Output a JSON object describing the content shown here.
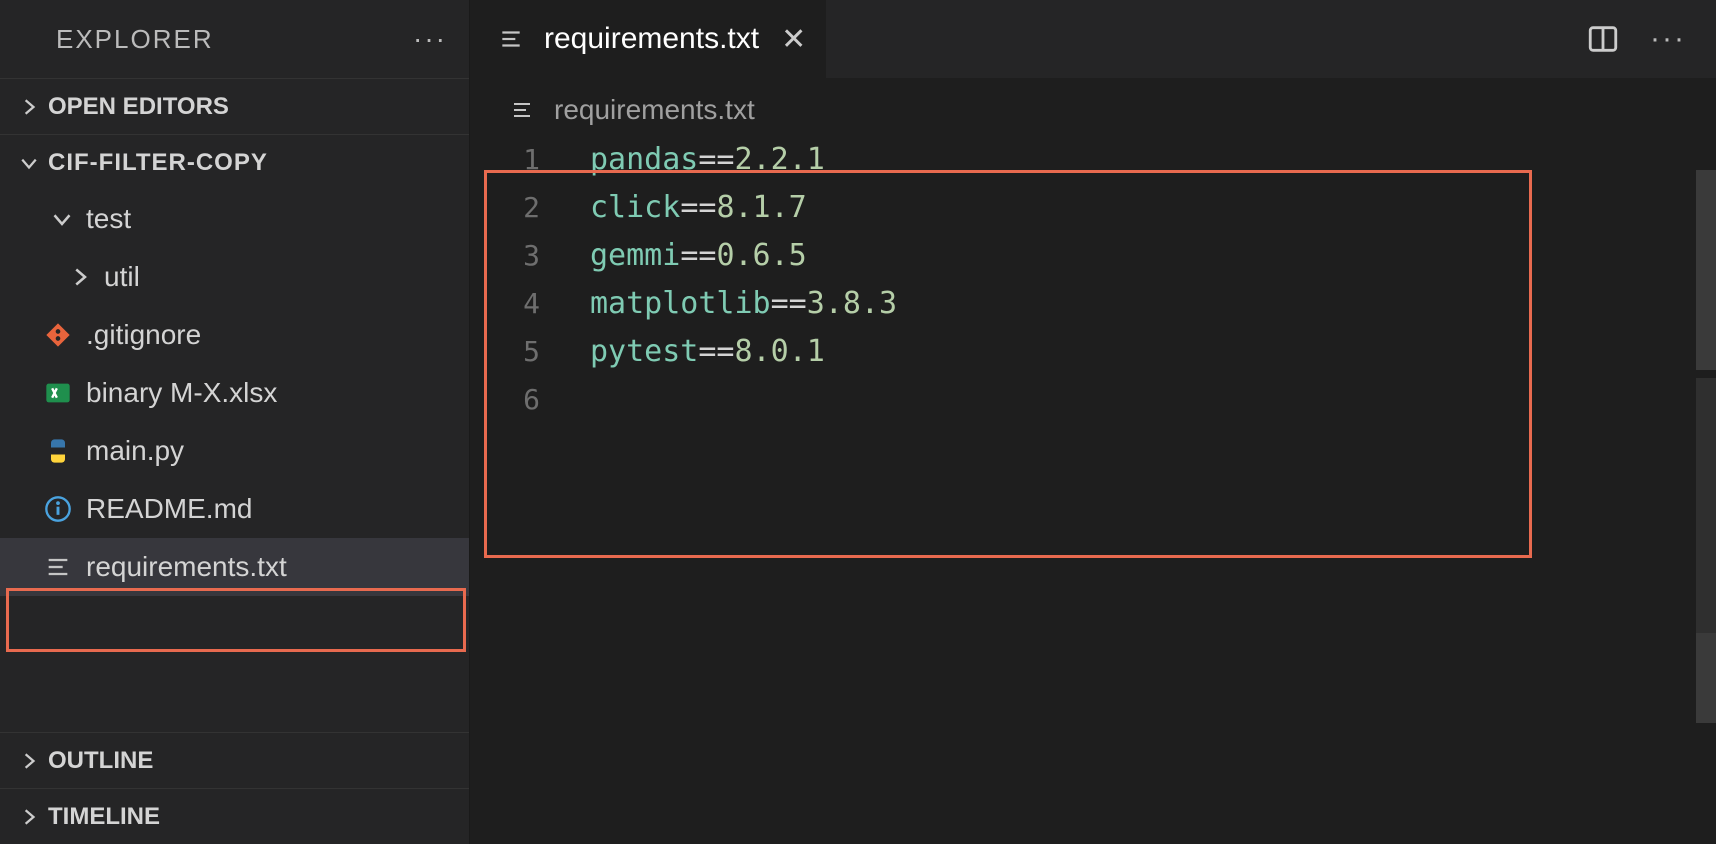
{
  "sidebar": {
    "title": "EXPLORER",
    "sections": {
      "open_editors": "OPEN EDITORS",
      "project": "CIF-FILTER-COPY",
      "outline": "OUTLINE",
      "timeline": "TIMELINE"
    },
    "tree": {
      "folders": [
        {
          "name": "test",
          "expanded": true
        },
        {
          "name": "util",
          "expanded": false
        }
      ],
      "files": [
        {
          "name": ".gitignore",
          "icon": "git"
        },
        {
          "name": "binary M-X.xlsx",
          "icon": "xlsx"
        },
        {
          "name": "main.py",
          "icon": "python"
        },
        {
          "name": "README.md",
          "icon": "info"
        },
        {
          "name": "requirements.txt",
          "icon": "lines",
          "active": true
        }
      ]
    }
  },
  "editor": {
    "tab": {
      "label": "requirements.txt",
      "icon": "lines"
    },
    "breadcrumb": {
      "label": "requirements.txt",
      "icon": "lines"
    },
    "lines": [
      {
        "n": 1,
        "pkg": "pandas",
        "op": "==",
        "ver": "2.2.1"
      },
      {
        "n": 2,
        "pkg": "click",
        "op": "==",
        "ver": "8.1.7"
      },
      {
        "n": 3,
        "pkg": "gemmi",
        "op": "==",
        "ver": "0.6.5"
      },
      {
        "n": 4,
        "pkg": "matplotlib",
        "op": "==",
        "ver": "3.8.3"
      },
      {
        "n": 5,
        "pkg": "pytest",
        "op": "==",
        "ver": "8.0.1"
      },
      {
        "n": 6,
        "pkg": "",
        "op": "",
        "ver": ""
      }
    ]
  }
}
